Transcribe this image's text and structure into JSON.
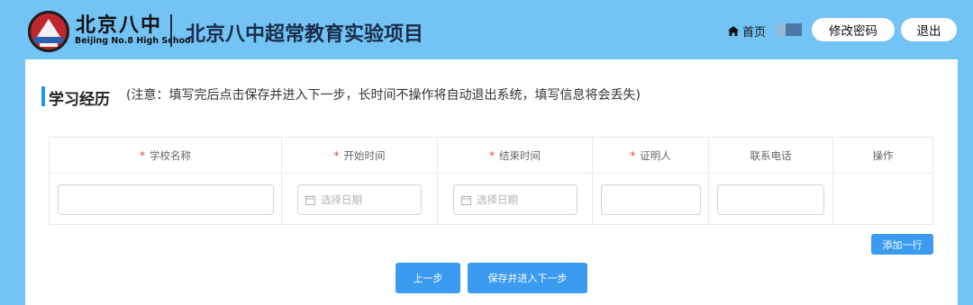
{
  "header": {
    "logo_cn": "北京八中",
    "logo_en": "Beijing No.8 High School",
    "title": "北京八中超常教育实验项目",
    "home_label": "首页",
    "change_password_label": "修改密码",
    "logout_label": "退出"
  },
  "section": {
    "title": "学习经历",
    "note": "(注意：填写完后点击保存并进入下一步，长时间不操作将自动退出系统，填写信息将会丢失)"
  },
  "table": {
    "columns": [
      {
        "label": "学校名称",
        "required": true
      },
      {
        "label": "开始时间",
        "required": true
      },
      {
        "label": "结束时间",
        "required": true
      },
      {
        "label": "证明人",
        "required": true
      },
      {
        "label": "联系电话",
        "required": false
      },
      {
        "label": "操作",
        "required": false
      }
    ],
    "required_mark": "*",
    "row": {
      "school_name": "",
      "start_date_placeholder": "选择日期",
      "end_date_placeholder": "选择日期",
      "witness": "",
      "phone": ""
    }
  },
  "actions": {
    "add_row_label": "添加一行",
    "prev_label": "上一步",
    "save_next_label": "保存并进入下一步"
  },
  "colors": {
    "background": "#73c3f5",
    "accent": "#3a9bf0",
    "required": "#e83e3e"
  }
}
